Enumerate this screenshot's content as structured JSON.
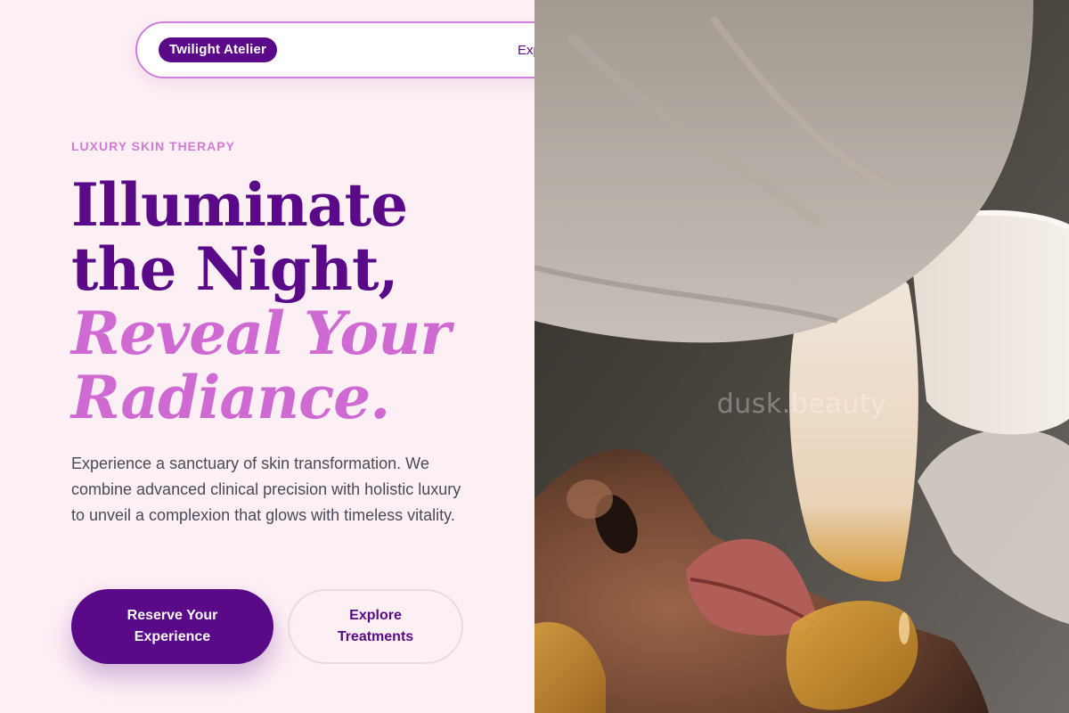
{
  "nav": {
    "brand": "Twilight Atelier",
    "link_partial": "Exp"
  },
  "hero": {
    "eyebrow": "LUXURY SKIN THERAPY",
    "title_line1": "Illuminate",
    "title_line2": "the Night,",
    "title_line3": "Reveal Your",
    "title_line4": "Radiance.",
    "body": "Experience a sanctuary of skin transformation. We combine advanced clinical precision with holistic luxury to unveil a complexion that glows with timeless vitality.",
    "primary_cta": "Reserve Your Experience",
    "secondary_cta": "Explore Treatments"
  },
  "image": {
    "watermark": "dusk.beauty",
    "description_icon": "spa-facial-photo"
  },
  "colors": {
    "brand_purple": "#5a0a88",
    "accent_orchid": "#d06ad3",
    "background_blush": "#fdf0f5",
    "body_text": "#4a4a58"
  }
}
